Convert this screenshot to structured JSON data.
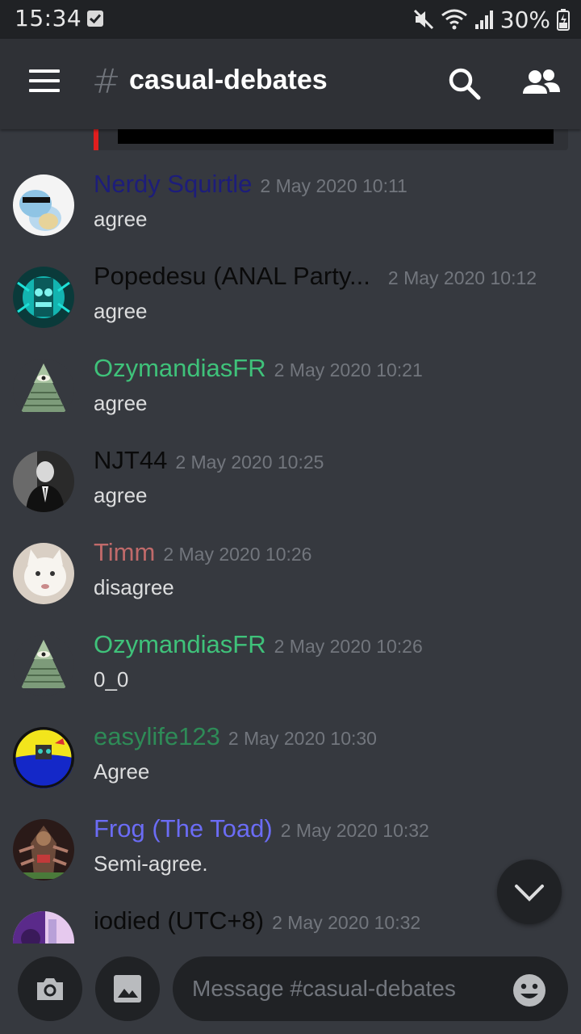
{
  "status_bar": {
    "time": "15:34",
    "battery": "30%",
    "icons": [
      "notification-check-icon",
      "mute-icon",
      "wifi-icon",
      "signal-icon",
      "battery-icon"
    ]
  },
  "header": {
    "hash": "#",
    "channel_name": "casual-debates",
    "icons": [
      "hamburger-menu-icon",
      "search-icon",
      "members-icon"
    ]
  },
  "messages": [
    {
      "username": "Nerdy Squirtle",
      "username_color": "#1d1d7a",
      "timestamp": "2 May 2020 10:11",
      "text": "agree",
      "avatar": "squirtle-sunglasses-avatar"
    },
    {
      "username": "Popedesu (ANAL Party...",
      "username_color": "#0a0a0a",
      "timestamp": "2 May 2020 10:12",
      "text": "agree",
      "avatar": "cyan-idol-avatar"
    },
    {
      "username": "OzymandiasFR",
      "username_color": "#3fc27a",
      "timestamp": "2 May 2020 10:21",
      "text": "agree",
      "avatar": "eye-pyramid-avatar"
    },
    {
      "username": "NJT44",
      "username_color": "#0a0a0a",
      "timestamp": "2 May 2020 10:25",
      "text": "agree",
      "avatar": "suited-man-avatar"
    },
    {
      "username": "Timm",
      "username_color": "#c06a6a",
      "timestamp": "2 May 2020 10:26",
      "text": "disagree",
      "avatar": "white-cat-avatar"
    },
    {
      "username": "OzymandiasFR",
      "username_color": "#3fc27a",
      "timestamp": "2 May 2020 10:26",
      "text": "0_0",
      "avatar": "eye-pyramid-avatar"
    },
    {
      "username": "easylife123",
      "username_color": "#2e8b57",
      "timestamp": "2 May 2020 10:30",
      "text": "Agree",
      "avatar": "yellow-blue-ball-avatar"
    },
    {
      "username": "Frog (The Toad)",
      "username_color": "#6b6cf5",
      "timestamp": "2 May 2020 10:32",
      "text": "Semi-agree.",
      "avatar": "dark-idol-avatar"
    },
    {
      "username": "iodied (UTC+8)",
      "username_color": "#0a0a0a",
      "timestamp": "2 May 2020 10:32",
      "text": "",
      "avatar": "purple-abstract-avatar"
    }
  ],
  "composer": {
    "placeholder": "Message #casual-debates",
    "icons": [
      "camera-icon",
      "image-icon",
      "emoji-icon",
      "scroll-down-chevron-icon"
    ]
  },
  "colors": {
    "background": "#36393f",
    "header": "#2f3136",
    "status_bar": "#202225",
    "timestamp": "#72767d",
    "embed_accent": "#e01e1e"
  }
}
